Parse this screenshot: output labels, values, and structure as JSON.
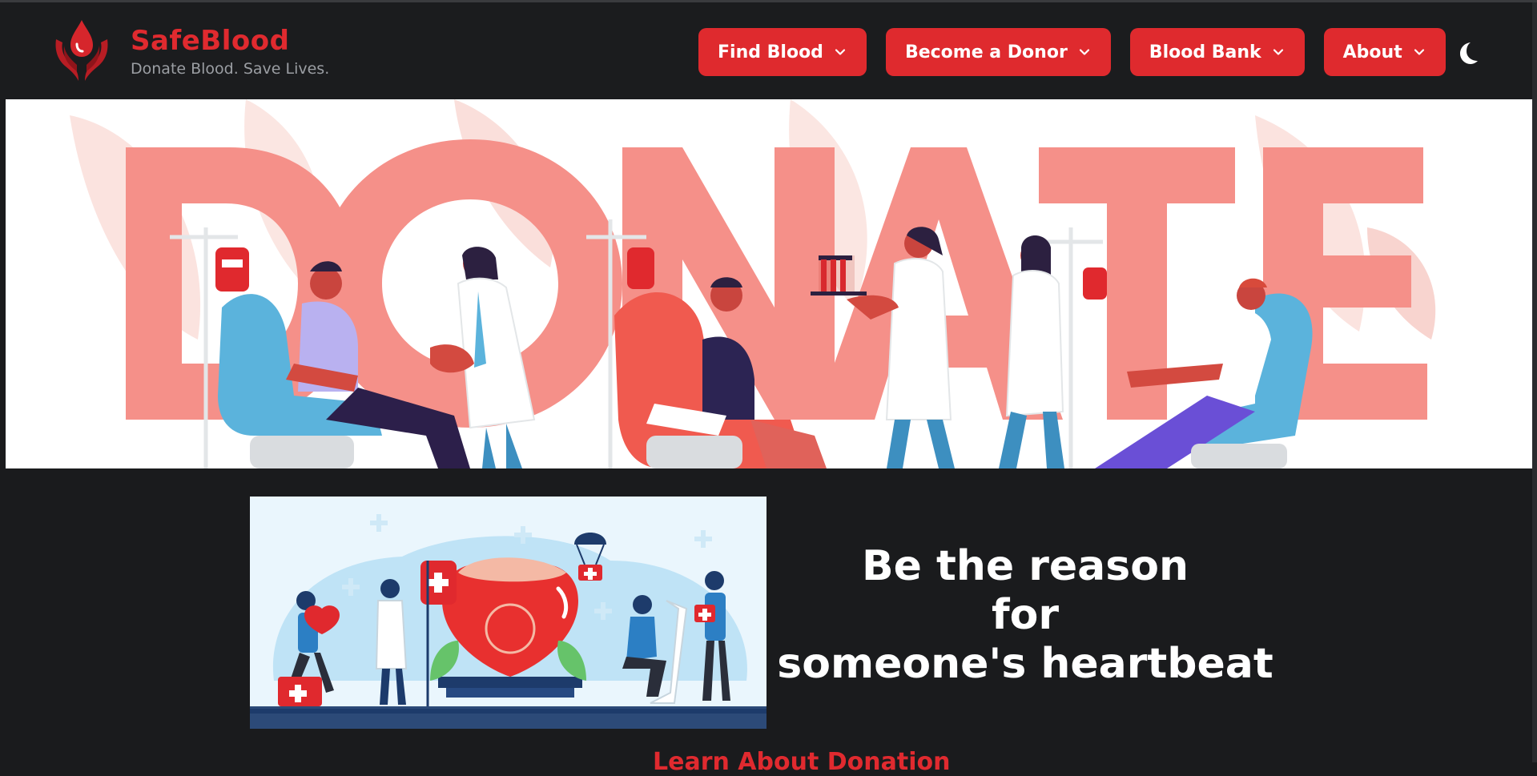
{
  "brand": {
    "name": "SafeBlood",
    "tagline": "Donate Blood. Save Lives.",
    "logo_icon": "blood-drop-hands-icon",
    "color": "#e02a2f"
  },
  "nav": {
    "items": [
      {
        "label": "Find Blood",
        "icon": "chevron-down-icon"
      },
      {
        "label": "Become a Donor",
        "icon": "chevron-down-icon"
      },
      {
        "label": "Blood Bank",
        "icon": "chevron-down-icon"
      },
      {
        "label": "About",
        "icon": "chevron-down-icon"
      }
    ],
    "theme_toggle_icon": "moon-icon",
    "button_color": "#df2a2e"
  },
  "hero": {
    "banner_text": "DONATE"
  },
  "section": {
    "tagline_lines": [
      "Be the reason",
      "for",
      "someone's heartbeat"
    ],
    "link_text": "Learn About Donation"
  },
  "colors": {
    "background": "#1a1b1d",
    "accent": "#e02a2f"
  }
}
